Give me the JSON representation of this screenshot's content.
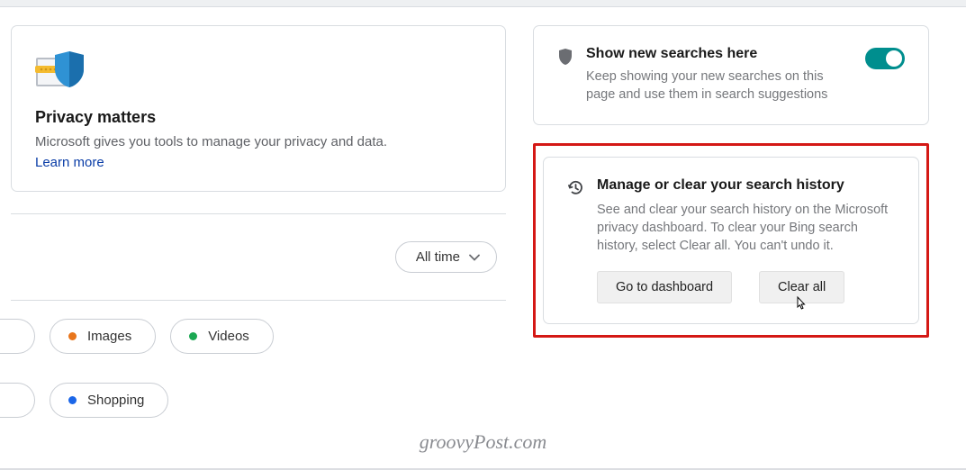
{
  "privacy": {
    "title": "Privacy matters",
    "desc": "Microsoft gives you tools to manage your privacy and data.",
    "learn_more": "Learn more"
  },
  "time_filter": {
    "label": "All time"
  },
  "chips": {
    "images": "Images",
    "videos": "Videos",
    "shopping": "Shopping"
  },
  "show_searches": {
    "title": "Show new searches here",
    "desc": "Keep showing your new searches on this page and use them in search suggestions"
  },
  "manage": {
    "title": "Manage or clear your search history",
    "desc": "See and clear your search history on the Microsoft privacy dashboard. To clear your Bing search history, select Clear all. You can't undo it.",
    "dashboard_btn": "Go to dashboard",
    "clear_btn": "Clear all"
  },
  "watermark": "groovyPost.com"
}
